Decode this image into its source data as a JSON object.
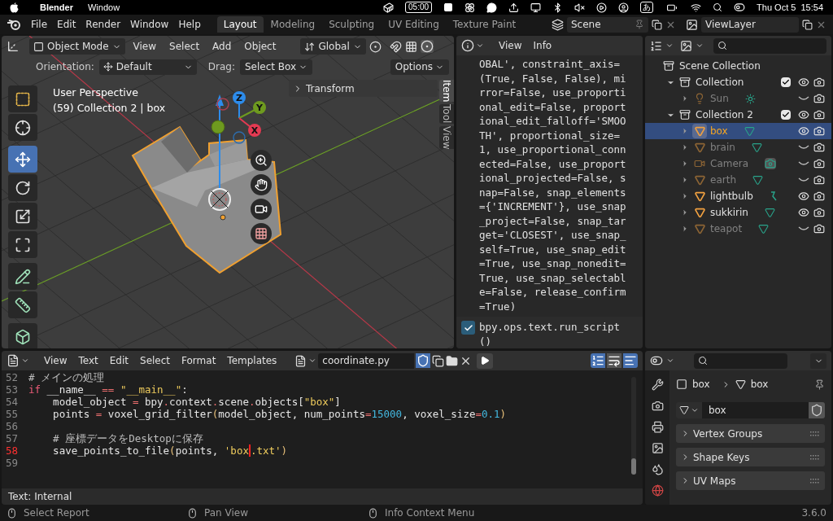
{
  "menubar": {
    "app": "Blender",
    "menus": [
      "Window"
    ],
    "timer": "05:00",
    "input_mode": "あ",
    "datetime": "Thu Oct 5  15:54"
  },
  "topbar": {
    "menus": [
      "File",
      "Edit",
      "Render",
      "Window",
      "Help"
    ],
    "workspaces": [
      {
        "label": "Layout",
        "selected": true
      },
      {
        "label": "Modeling",
        "selected": false
      },
      {
        "label": "Sculpting",
        "selected": false
      },
      {
        "label": "UV Editing",
        "selected": false
      },
      {
        "label": "Texture Paint",
        "selected": false
      }
    ],
    "scene": "Scene",
    "view_layer": "ViewLayer"
  },
  "viewport": {
    "mode": "Object Mode",
    "menus": [
      "View",
      "Select",
      "Add",
      "Object"
    ],
    "orientation": "Global",
    "tool_settings": {
      "orientation_label": "Orientation:",
      "orientation": "Default",
      "drag_label": "Drag:",
      "drag": "Select Box",
      "options": "Options"
    },
    "overlay_lines": [
      "User Perspective",
      "(59) Collection 2 | box"
    ],
    "tools": [
      {
        "kind": "select",
        "selected": false
      },
      {
        "kind": "cursor",
        "selected": false
      },
      {
        "kind": "move",
        "selected": true
      },
      {
        "kind": "rotate",
        "selected": false
      },
      {
        "kind": "scale",
        "selected": false
      },
      {
        "kind": "transform",
        "selected": false
      },
      {
        "kind": "annotate",
        "selected": false
      },
      {
        "kind": "measure",
        "selected": false
      },
      {
        "kind": "add_cube",
        "selected": false
      }
    ],
    "transform_panel": {
      "title": "Transform",
      "expanded": false
    },
    "side_tabs": [
      {
        "label": "Item",
        "selected": true
      },
      {
        "label": "Tool",
        "selected": false
      },
      {
        "label": "View",
        "selected": false
      }
    ],
    "gizmo": {
      "x": "X",
      "y": "Y",
      "z": "Z"
    }
  },
  "info": {
    "menus": [
      "View",
      "Info"
    ],
    "reports": [
      {
        "kind": "continued",
        "text": "OBAL', constraint_axis=(True, False, False), mirror=False, use_proportional_edit=False, proportional_edit_falloff='SMOOTH', proportional_size=1, use_proportional_connected=False, use_proportional_projected=False, snap=False, snap_elements={'INCREMENT'}, use_snap_project=False, snap_target='CLOSEST', use_snap_self=True, use_snap_edit=True, use_snap_nonedit=True, use_snap_selectable=False, release_confirm=True)"
      },
      {
        "kind": "report",
        "checked": true,
        "text": "bpy.ops.text.run_script()"
      }
    ]
  },
  "outliner": {
    "root": "Scene Collection",
    "children": [
      {
        "name": "Collection",
        "kind": "collection",
        "expanded": true,
        "checked": true,
        "visible": true,
        "selected": false,
        "children": [
          {
            "name": "Sun",
            "kind": "light",
            "data": {
              "kind": "sun"
            },
            "visible": false,
            "selected": false
          }
        ]
      },
      {
        "name": "Collection 2",
        "kind": "collection",
        "expanded": true,
        "checked": true,
        "visible": true,
        "selected": false,
        "children": [
          {
            "name": "box",
            "kind": "mesh",
            "data": {
              "kind": "mesh"
            },
            "visible": true,
            "selected": true
          },
          {
            "name": "brain",
            "kind": "mesh",
            "data": {
              "kind": "mesh"
            },
            "visible": false,
            "selected": false
          },
          {
            "name": "Camera",
            "kind": "camera",
            "data": {
              "kind": "camera"
            },
            "visible": false,
            "selected": false
          },
          {
            "name": "earth",
            "kind": "mesh",
            "data": {
              "kind": "mesh"
            },
            "visible": false,
            "selected": false
          },
          {
            "name": "lightbulb",
            "kind": "mesh",
            "data": {
              "kind": "curve"
            },
            "visible": true,
            "selected": false
          },
          {
            "name": "sukkirin",
            "kind": "mesh",
            "data": {
              "kind": "mesh"
            },
            "visible": true,
            "selected": false
          },
          {
            "name": "teapot",
            "kind": "mesh",
            "data": {
              "kind": "mesh"
            },
            "visible": false,
            "selected": false
          }
        ]
      }
    ]
  },
  "text_editor": {
    "menus": [
      "View",
      "Text",
      "Edit",
      "Select",
      "Format",
      "Templates"
    ],
    "file": "coordinate.py",
    "footer": "Text: Internal",
    "lines": [
      {
        "number": "52",
        "current": false,
        "segments": [
          {
            "kind": "comment",
            "text": "# メインの処理"
          }
        ]
      },
      {
        "number": "53",
        "current": false,
        "segments": [
          {
            "kind": "keyword",
            "text": "if"
          },
          {
            "kind": "plain",
            "text": " __name__ "
          },
          {
            "kind": "symbol",
            "text": "=="
          },
          {
            "kind": "string",
            "text": " \"__main__\""
          },
          {
            "kind": "plain",
            "text": ":"
          }
        ]
      },
      {
        "number": "54",
        "current": false,
        "segments": [
          {
            "kind": "plain",
            "text": "    model_object "
          },
          {
            "kind": "symbol",
            "text": "="
          },
          {
            "kind": "plain",
            "text": " bpy"
          },
          {
            "kind": "symbol",
            "text": "."
          },
          {
            "kind": "plain",
            "text": "context"
          },
          {
            "kind": "symbol",
            "text": "."
          },
          {
            "kind": "plain",
            "text": "scene"
          },
          {
            "kind": "symbol",
            "text": "."
          },
          {
            "kind": "plain",
            "text": "objects["
          },
          {
            "kind": "string",
            "text": "\"box\""
          },
          {
            "kind": "plain",
            "text": "]"
          }
        ]
      },
      {
        "number": "55",
        "current": false,
        "segments": [
          {
            "kind": "plain",
            "text": "    points "
          },
          {
            "kind": "symbol",
            "text": "="
          },
          {
            "kind": "plain",
            "text": " voxel_grid_filter"
          },
          {
            "kind": "paren",
            "text": "("
          },
          {
            "kind": "plain",
            "text": "model_object, num_points"
          },
          {
            "kind": "symbol",
            "text": "="
          },
          {
            "kind": "number",
            "text": "15000"
          },
          {
            "kind": "plain",
            "text": ", voxel_size"
          },
          {
            "kind": "symbol",
            "text": "="
          },
          {
            "kind": "number",
            "text": "0.1"
          },
          {
            "kind": "paren",
            "text": ")"
          }
        ]
      },
      {
        "number": "56",
        "current": false
      },
      {
        "number": "57",
        "current": false,
        "segments": [
          {
            "kind": "comment",
            "text": "    # 座標データをDesktopに保存"
          }
        ]
      },
      {
        "number": "58",
        "current": true,
        "segments": [
          {
            "kind": "plain",
            "text": "    save_points_to_file"
          },
          {
            "kind": "paren",
            "text": "("
          },
          {
            "kind": "plain",
            "text": "points, "
          },
          {
            "kind": "string",
            "text": "'box",
            "cursor_after": true
          },
          {
            "kind": "string",
            "text": ".txt'"
          },
          {
            "kind": "paren",
            "text": ")"
          }
        ]
      },
      {
        "number": "59",
        "current": false
      }
    ]
  },
  "properties": {
    "breadcrumb": [
      "box",
      "box"
    ],
    "data_name": "box",
    "panels": [
      {
        "title": "Vertex Groups",
        "expanded": false
      },
      {
        "title": "Shape Keys",
        "expanded": false
      },
      {
        "title": "UV Maps",
        "expanded": false
      }
    ]
  },
  "status_bar": {
    "hints": [
      "Select Report",
      "Pan View",
      "Info Context Menu"
    ],
    "version": "3.6.0"
  }
}
